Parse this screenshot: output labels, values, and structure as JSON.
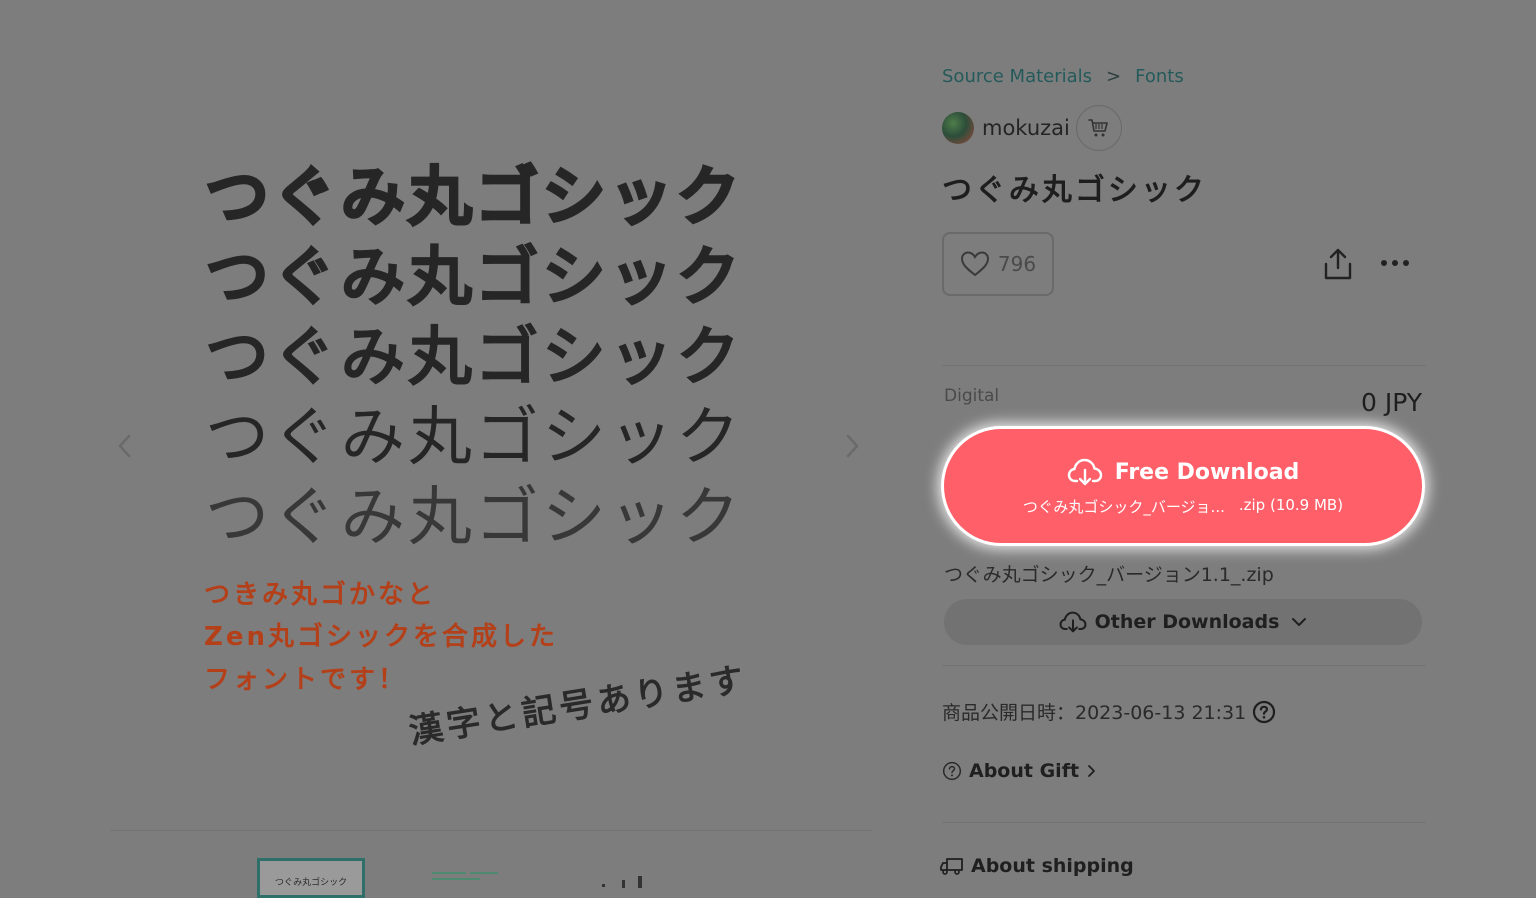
{
  "preview": {
    "font_sample": "つぐみ丸ゴシック",
    "caption_lines": [
      "つきみ丸ゴかなと",
      "Zen丸ゴシックを合成した",
      "フォントです！"
    ],
    "tilted_caption": "漢字と記号あります",
    "thumbnail_text": "つぐみ丸ゴシック"
  },
  "breadcrumb": {
    "items": [
      "Source Materials",
      "Fonts"
    ],
    "separator": ">"
  },
  "author": {
    "name": "mokuzai"
  },
  "product": {
    "title": "つぐみ丸ゴシック",
    "likes": "796"
  },
  "pricing": {
    "type_label": "Digital",
    "price": "0 JPY"
  },
  "download": {
    "button_label": "Free Download",
    "file_short": "つぐみ丸ゴシック_バージョ...",
    "file_meta": ".zip (10.9 MB)",
    "file_full": "つぐみ丸ゴシック_バージョン1.1_.zip",
    "other_label": "Other Downloads"
  },
  "info": {
    "published": "商品公開日時：2023-06-13 21:31",
    "about_gift": "About Gift",
    "about_shipping": "About shipping"
  },
  "colors": {
    "background_overlay": "#7d7d7d",
    "download_button": "#ff5f69",
    "breadcrumb_link": "#245a5a",
    "caption_orange": "#b4401a"
  },
  "icons": {
    "cart": "cart-icon",
    "heart": "heart-icon",
    "share": "share-icon",
    "more": "more-icon",
    "cloud_download": "cloud-download-icon",
    "chevron_down": "chevron-down-icon",
    "help": "question-circle-icon",
    "truck": "truck-icon"
  }
}
